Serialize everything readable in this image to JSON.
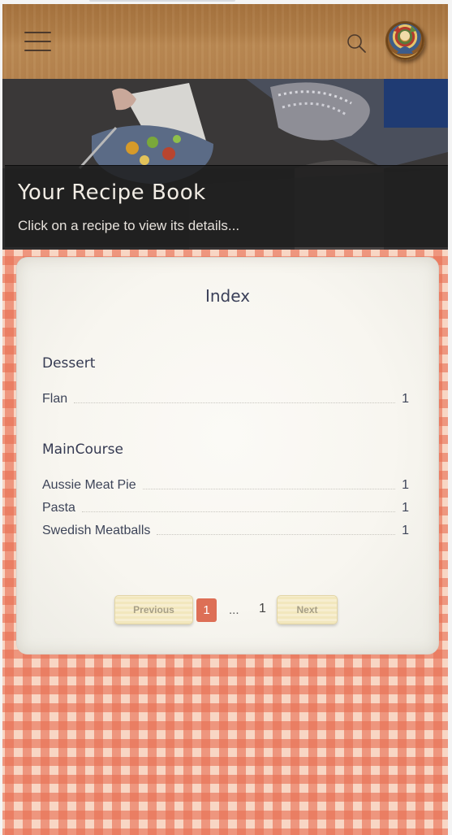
{
  "header": {
    "menu_icon": "hamburger-menu-icon",
    "search_icon": "search-icon",
    "avatar": "user-avatar"
  },
  "hero": {
    "title": "Your Recipe Book",
    "subtitle": "Click on a recipe to view its details..."
  },
  "index": {
    "title": "Index",
    "categories": [
      {
        "name": "Dessert",
        "recipes": [
          {
            "name": "Flan",
            "page": "1"
          }
        ]
      },
      {
        "name": "MainCourse",
        "recipes": [
          {
            "name": "Aussie Meat Pie",
            "page": "1"
          },
          {
            "name": "Pasta",
            "page": "1"
          },
          {
            "name": "Swedish Meatballs",
            "page": "1"
          }
        ]
      }
    ]
  },
  "pagination": {
    "previous_label": "Previous",
    "current_page": "1",
    "ellipsis": "...",
    "last_page": "1",
    "next_label": "Next"
  },
  "colors": {
    "header_wood": "#b07e48",
    "tablecloth_red": "#e87052",
    "accent_page": "#dd6f56",
    "text_dark": "#3a3f58"
  }
}
